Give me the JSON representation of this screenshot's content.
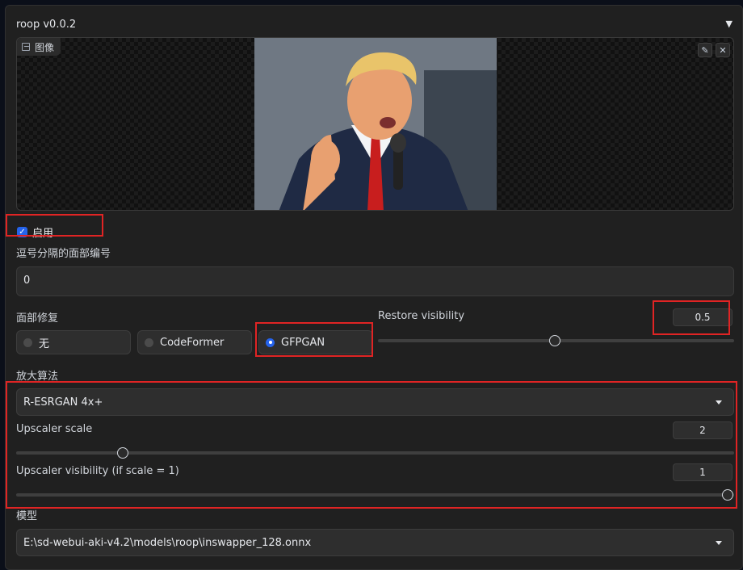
{
  "panel": {
    "title": "roop v0.0.2",
    "collapse_glyph": "▼"
  },
  "image": {
    "label": "图像",
    "tools": {
      "edit_icon": "✎",
      "close_icon": "✕"
    }
  },
  "enable": {
    "label": "启用",
    "checked": true
  },
  "face_index": {
    "label": "逗号分隔的面部编号",
    "value": "0"
  },
  "restore_face": {
    "label": "面部修复",
    "options": [
      {
        "label": "无",
        "selected": false
      },
      {
        "label": "CodeFormer",
        "selected": false
      },
      {
        "label": "GFPGAN",
        "selected": true
      }
    ]
  },
  "restore_visibility": {
    "label": "Restore visibility",
    "value": "0.5",
    "fraction": 0.5
  },
  "upscaler": {
    "label": "放大算法",
    "selected": "R-ESRGAN 4x+",
    "scale": {
      "label": "Upscaler scale",
      "value": "2",
      "fraction": 0.15
    },
    "visibility": {
      "label": "Upscaler visibility (if scale = 1)",
      "value": "1",
      "fraction": 1.0
    }
  },
  "model": {
    "label": "模型",
    "selected": "E:\\sd-webui-aki-v4.2\\models\\roop\\inswapper_128.onnx"
  },
  "colors": {
    "accent": "#2563eb",
    "highlight": "#e02424",
    "panel": "#202020"
  }
}
